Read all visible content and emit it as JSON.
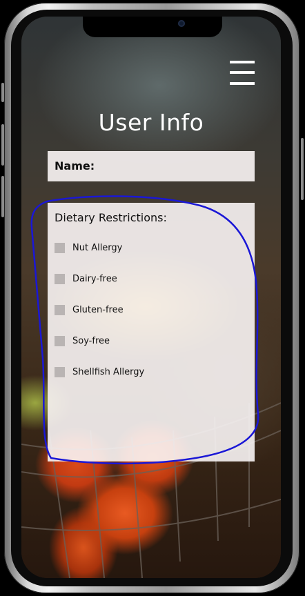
{
  "screen": {
    "title": "User Info"
  },
  "menu": {
    "icon": "hamburger-menu-icon"
  },
  "form": {
    "name_label": "Name:",
    "dietary_title": "Dietary Restrictions:",
    "options": [
      {
        "label": "Nut Allergy",
        "checked": false
      },
      {
        "label": "Dairy-free",
        "checked": false
      },
      {
        "label": "Gluten-free",
        "checked": false
      },
      {
        "label": "Soy-free",
        "checked": false
      },
      {
        "label": "Shellfish Allergy",
        "checked": false
      }
    ]
  },
  "colors": {
    "annotation_stroke": "#1a17d6",
    "panel_bg": "#f5f0f0",
    "checkbox": "#b9b4b3"
  }
}
